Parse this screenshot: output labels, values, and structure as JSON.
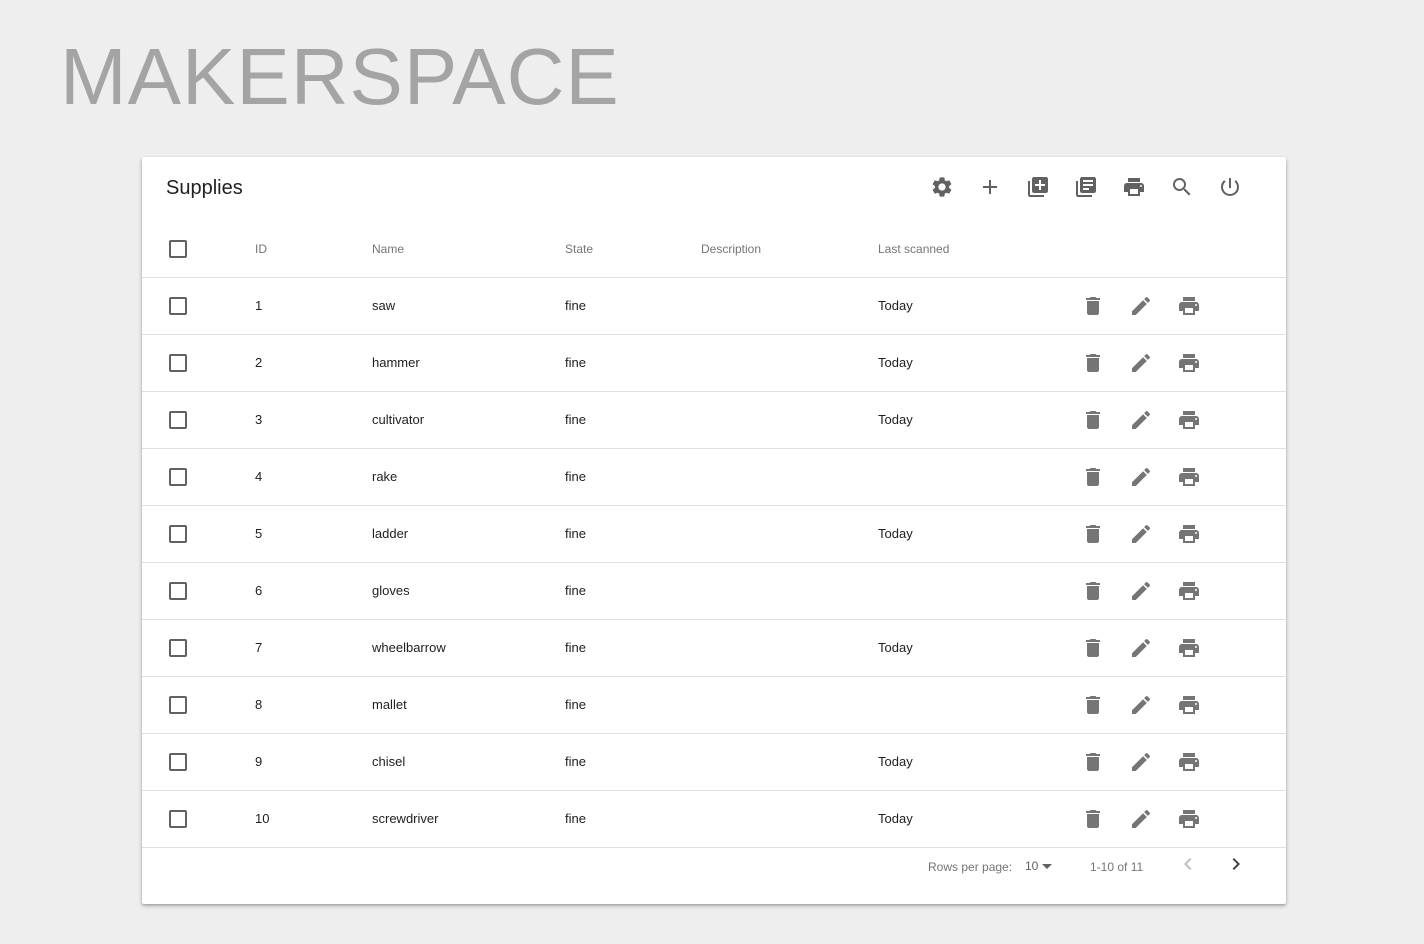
{
  "app": {
    "brand": "MAKERSPACE"
  },
  "card": {
    "title": "Supplies",
    "toolbar": [
      {
        "name": "settings-icon",
        "label": "settings"
      },
      {
        "name": "add-icon",
        "label": "add"
      },
      {
        "name": "add-multiple-icon",
        "label": "add multiple"
      },
      {
        "name": "library-books-icon",
        "label": "library books"
      },
      {
        "name": "print-icon",
        "label": "print"
      },
      {
        "name": "search-icon",
        "label": "search"
      },
      {
        "name": "power-icon",
        "label": "power"
      }
    ]
  },
  "table": {
    "columns": {
      "id": "ID",
      "name": "Name",
      "state": "State",
      "description": "Description",
      "last_scanned": "Last scanned"
    },
    "rows": [
      {
        "id": "1",
        "name": "saw",
        "state": "fine",
        "description": "",
        "last_scanned": "Today"
      },
      {
        "id": "2",
        "name": "hammer",
        "state": "fine",
        "description": "",
        "last_scanned": "Today"
      },
      {
        "id": "3",
        "name": "cultivator",
        "state": "fine",
        "description": "",
        "last_scanned": "Today"
      },
      {
        "id": "4",
        "name": "rake",
        "state": "fine",
        "description": "",
        "last_scanned": ""
      },
      {
        "id": "5",
        "name": "ladder",
        "state": "fine",
        "description": "",
        "last_scanned": "Today"
      },
      {
        "id": "6",
        "name": "gloves",
        "state": "fine",
        "description": "",
        "last_scanned": ""
      },
      {
        "id": "7",
        "name": "wheelbarrow",
        "state": "fine",
        "description": "",
        "last_scanned": "Today"
      },
      {
        "id": "8",
        "name": "mallet",
        "state": "fine",
        "description": "",
        "last_scanned": ""
      },
      {
        "id": "9",
        "name": "chisel",
        "state": "fine",
        "description": "",
        "last_scanned": "Today"
      },
      {
        "id": "10",
        "name": "screwdriver",
        "state": "fine",
        "description": "",
        "last_scanned": "Today"
      }
    ]
  },
  "pagination": {
    "rows_per_page_label": "Rows per page:",
    "rows_per_page": "10",
    "range": "1-10 of 11"
  },
  "colors": {
    "background": "#eeeeee",
    "brand": "#a4a4a4",
    "icon": "#616161",
    "divider": "#e0e0e0"
  }
}
